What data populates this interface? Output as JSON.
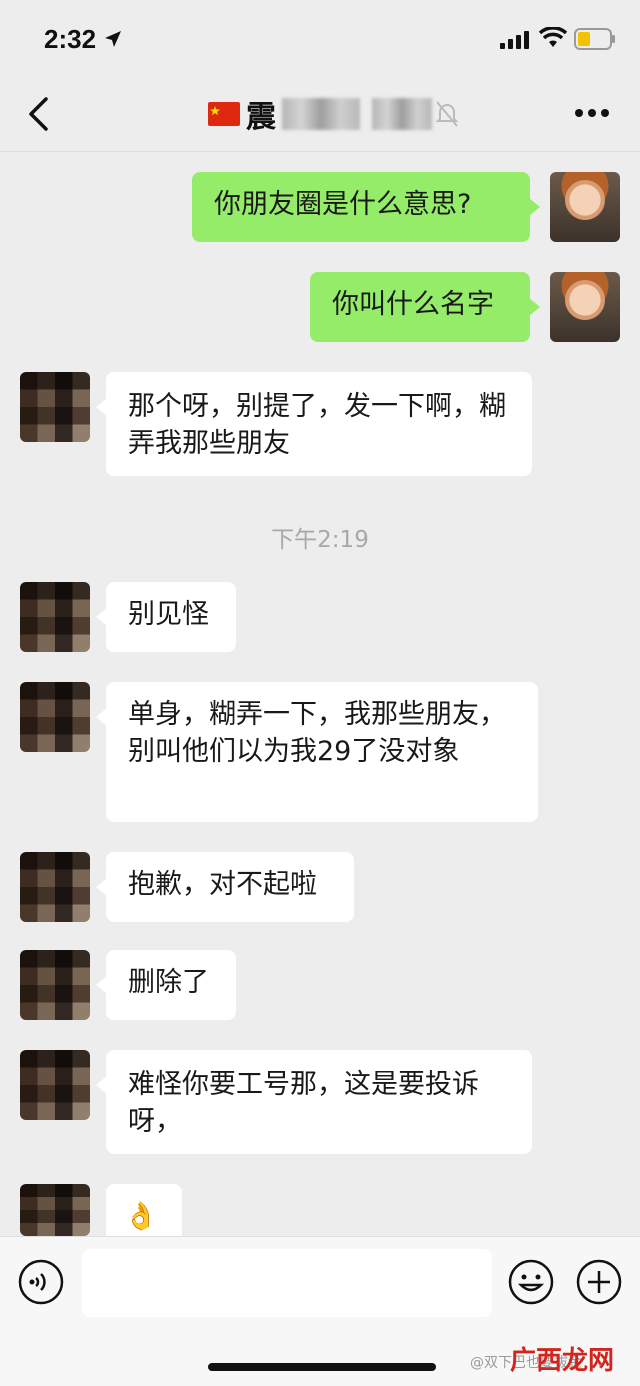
{
  "status_bar": {
    "time": "2:32"
  },
  "nav": {
    "title": "震"
  },
  "messages": [
    {
      "side": "self",
      "text": "你朋友圈是什么意思?"
    },
    {
      "side": "self",
      "text": "你叫什么名字"
    },
    {
      "side": "other",
      "text": "那个呀，别提了，发一下啊，糊弄我那些朋友"
    },
    {
      "side": "other",
      "text": "别见怪"
    },
    {
      "side": "other",
      "text": "单身，糊弄一下，我那些朋友，别叫他们以为我29了没对象"
    },
    {
      "side": "other",
      "text": "抱歉，对不起啦"
    },
    {
      "side": "other",
      "text": "删除了"
    },
    {
      "side": "other",
      "text": "难怪你要工号那，这是要投诉呀，"
    },
    {
      "side": "other",
      "text": "👌"
    }
  ],
  "time_separator": "下午2:19",
  "input": {
    "value": ""
  },
  "watermark": "@双下巴也要拔金",
  "site_logo": "广西龙网",
  "colors": {
    "self_bubble": "#95ec69",
    "other_bubble": "#ffffff",
    "background": "#ededed"
  }
}
